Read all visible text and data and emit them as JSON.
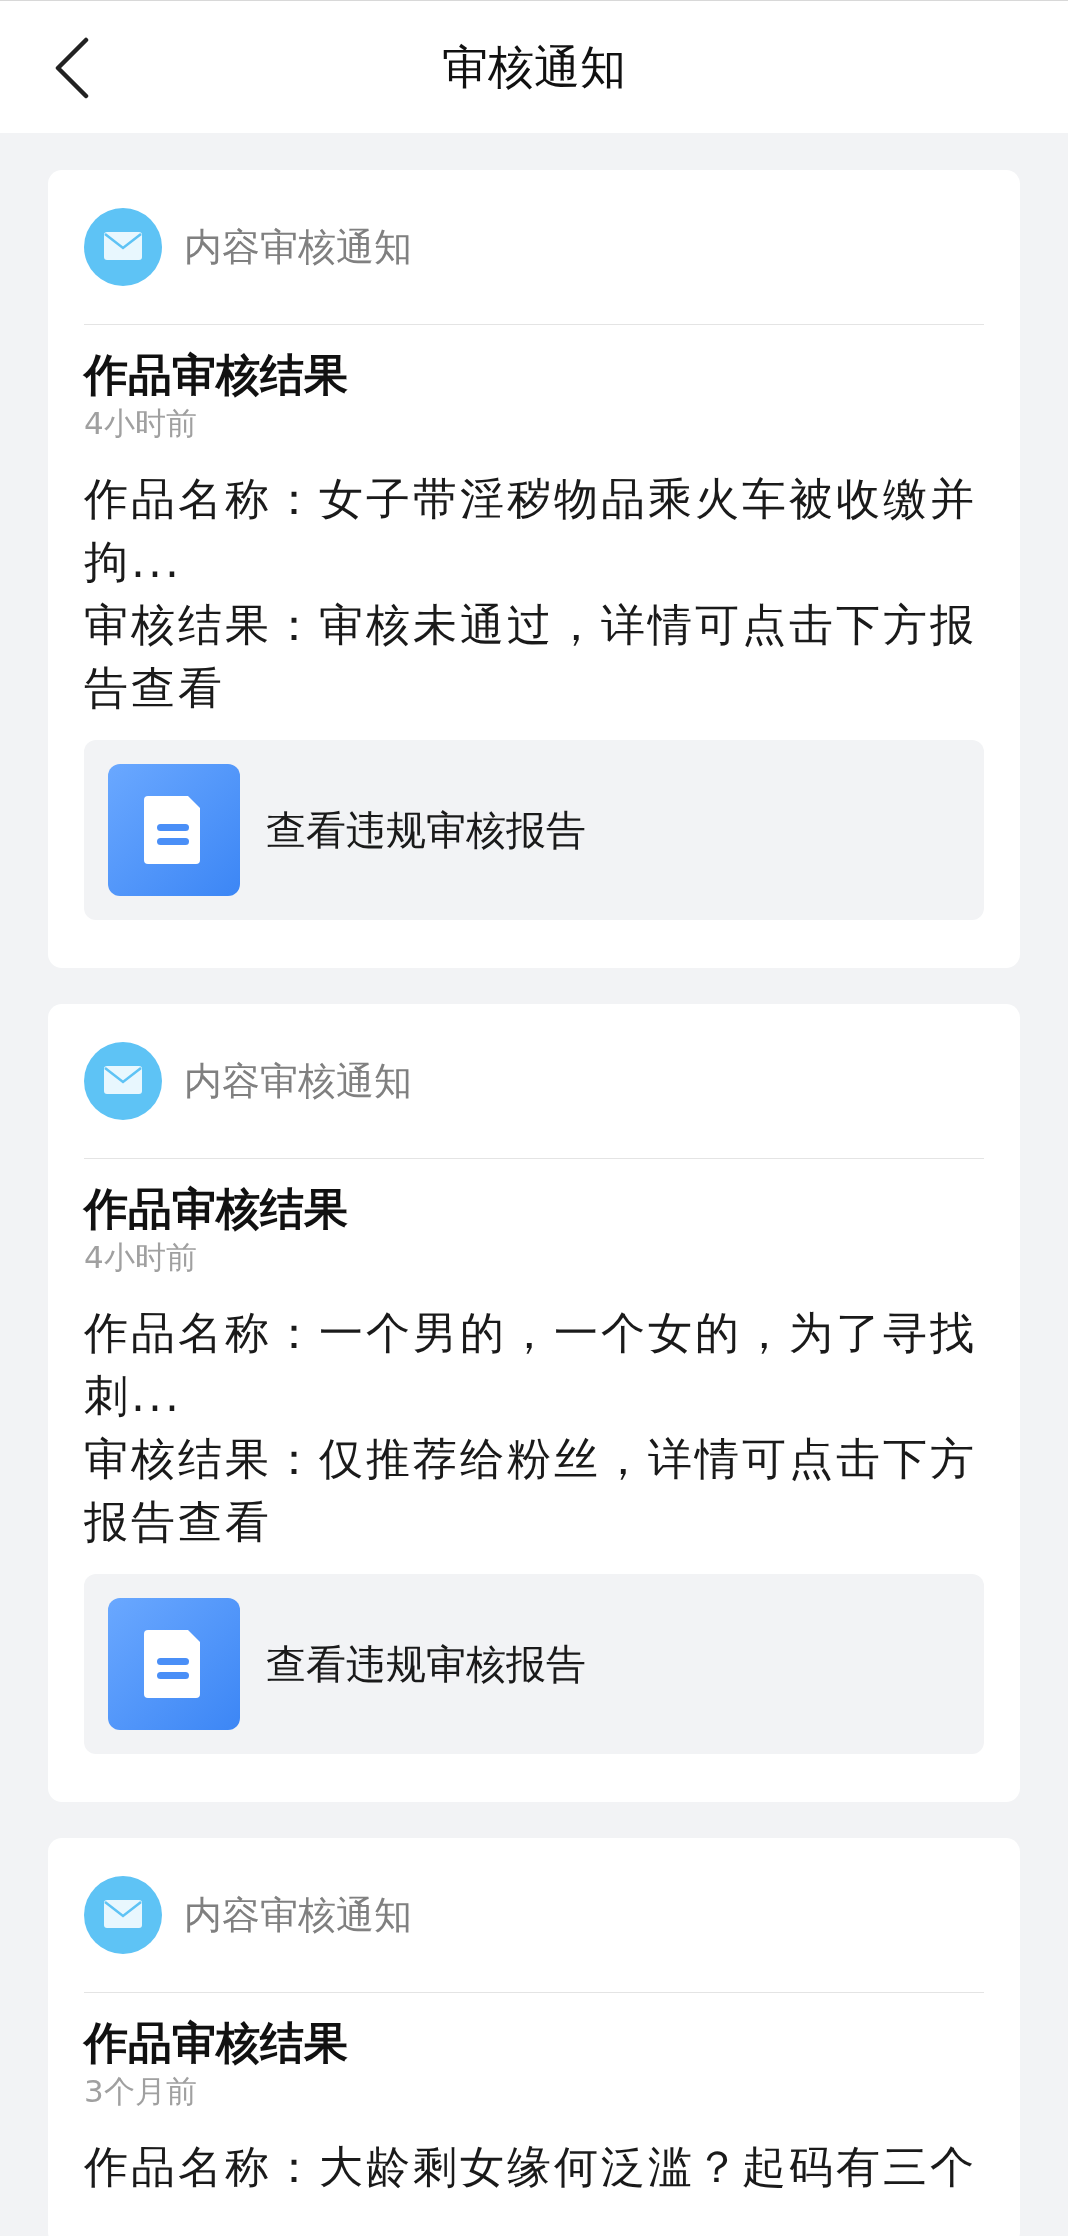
{
  "header": {
    "title": "审核通知"
  },
  "notices": [
    {
      "source": "内容审核通知",
      "title": "作品审核结果",
      "time": "4小时前",
      "work_name": "作品名称：女子带淫秽物品乘火车被收缴并拘...",
      "result": "审核结果：审核未通过，详情可点击下方报告查看",
      "report_link": "查看违规审核报告"
    },
    {
      "source": "内容审核通知",
      "title": "作品审核结果",
      "time": "4小时前",
      "work_name": "作品名称：一个男的，一个女的，为了寻找刺...",
      "result": "审核结果：仅推荐给粉丝，详情可点击下方报告查看",
      "report_link": "查看违规审核报告"
    },
    {
      "source": "内容审核通知",
      "title": "作品审核结果",
      "time": "3个月前",
      "work_name": "作品名称：大龄剩女缘何泛滥？起码有三个"
    }
  ]
}
